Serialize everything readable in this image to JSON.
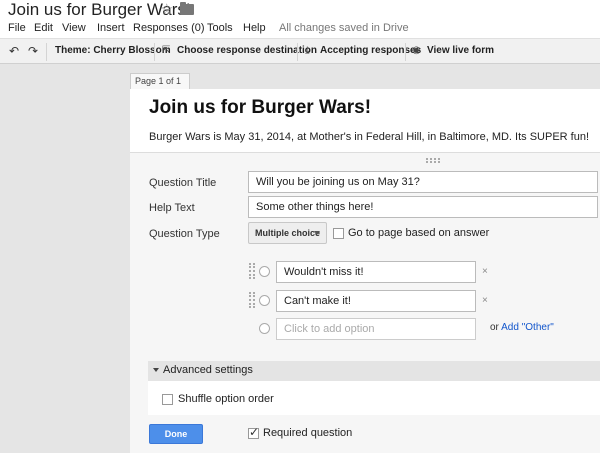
{
  "header": {
    "doc_title": "Join us for Burger Wars!",
    "star_icon": "star-outline-icon",
    "folder_icon": "folder-icon"
  },
  "menu": {
    "items": [
      "File",
      "Edit",
      "View",
      "Insert",
      "Responses (0)",
      "Tools",
      "Help"
    ],
    "status": "All changes saved in Drive"
  },
  "toolbar": {
    "undo_icon": "undo-icon",
    "redo_icon": "redo-icon",
    "theme": "Theme: Cherry Blossom",
    "destination": "Choose response destination",
    "accepting": "Accepting responses",
    "live_form": "View live form"
  },
  "page": {
    "tab": "Page 1 of 1",
    "title": "Join us for Burger Wars!",
    "description": "Burger Wars is May 31, 2014, at Mother's in Federal Hill, in Baltimore, MD. Its SUPER fun!"
  },
  "question": {
    "title_label": "Question Title",
    "title_value": "Will you be joining us on May 31?",
    "help_label": "Help Text",
    "help_value": "Some other things here!",
    "type_label": "Question Type",
    "type_value": "Multiple choice",
    "goto_label": "Go to page based on answer",
    "options": [
      "Wouldn't miss it!",
      "Can't make it!"
    ],
    "add_option_placeholder": "Click to add option",
    "or_text": "or",
    "add_other": "Add \"Other\""
  },
  "advanced": {
    "header": "Advanced settings",
    "shuffle_label": "Shuffle option order"
  },
  "footer": {
    "done_label": "Done",
    "required_label": "Required question"
  }
}
